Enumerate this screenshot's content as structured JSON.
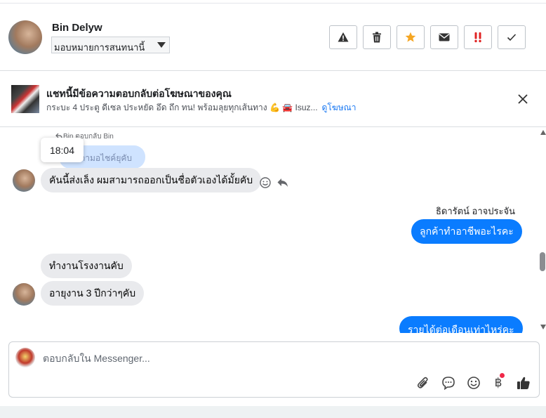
{
  "header": {
    "contact_name": "Bin Delyw",
    "assign_label": "มอบหมายการสนทนานี้",
    "actions": [
      "report-spam",
      "delete",
      "star",
      "mark-unread",
      "important",
      "done"
    ]
  },
  "ad_banner": {
    "title": "แชทนี้มีข้อความตอบกลับต่อโฆษณาของคุณ",
    "description": "กระบะ 4 ประตู ดีเซล ประหยัด อึด ถึก ทน! พร้อมลุยทุกเส้นทาง 💪 🚘 Isuz...",
    "link": "ดูโฆษณา"
  },
  "chat": {
    "reply_note": "Bin ตอบกลับ Bin",
    "quoted_text": "ถามอไชค์ยุคับ",
    "tooltip_time": "18:04",
    "messages": [
      {
        "text": "คันนี้ส่งเล็ง ผมสามารถออกเป็นชื่อตัวเองได้มั้ยคับ",
        "direction": "in"
      },
      {
        "sender": "ธิดารัตน์ อาจประจัน",
        "text": "ลูกค้าทำอาชีพอะไรคะ",
        "direction": "out"
      },
      {
        "text": "ทำงานโรงงานคับ",
        "direction": "in"
      },
      {
        "text": "อายุงาน 3 ปีกว่าๆคับ",
        "direction": "in"
      },
      {
        "text": "รายได้ต่อเดือนเท่าไหร่คะ",
        "direction": "out"
      }
    ]
  },
  "composer": {
    "placeholder": "ตอบกลับใน Messenger...",
    "tools": [
      "attach-icon",
      "saved-reply-icon",
      "emoji-icon",
      "payment-icon",
      "like-icon"
    ],
    "payment_glyph": "฿"
  },
  "colors": {
    "outgoing_bubble": "#0a7cff",
    "incoming_bubble": "#e9eaed",
    "link": "#1877f2",
    "star": "#f5a623",
    "important": "#e02424"
  }
}
